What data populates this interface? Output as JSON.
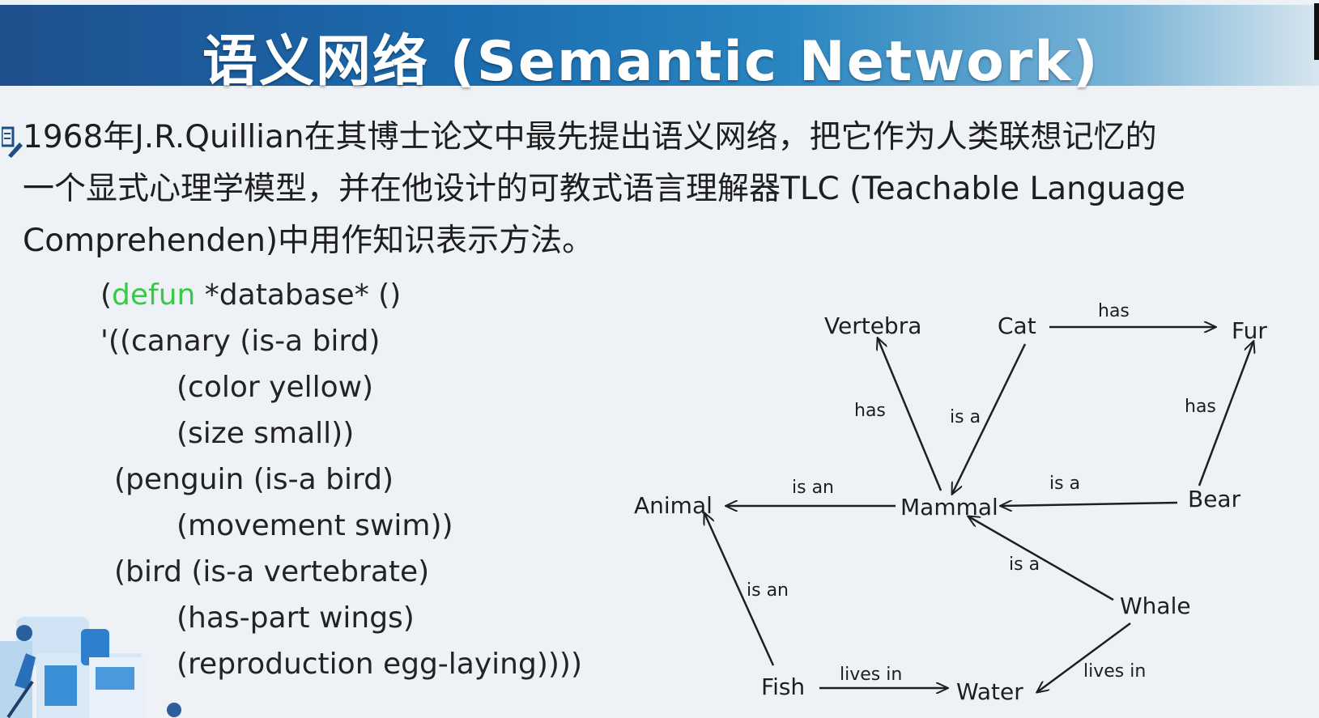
{
  "header": {
    "title": "语义网络 (Semantic Network)"
  },
  "intro": {
    "lines": [
      "1968年J.R.Quillian在其博士论文中最先提出语义网络，把它作为人类联想记忆的",
      "一个显式心理学模型，并在他设计的可教式语言理解器TLC (Teachable Language",
      "Comprehenden)中用作知识表示方法。"
    ]
  },
  "code": {
    "line1_open": "(",
    "line1_keyword": "defun",
    "line1_rest": " *database* ()",
    "line2": "'((canary  (is-a bird)",
    "line3": "(color yellow)",
    "line4": "(size small))",
    "line5": "(penguin (is-a bird)",
    "line6": "(movement swim))",
    "line7": "(bird    (is-a vertebrate)",
    "line8": "(has-part wings)",
    "line9": "(reproduction egg-laying))))",
    "keyword_color": "#39c84a"
  },
  "diagram": {
    "nodes": {
      "vertebra": "Vertebra",
      "cat": "Cat",
      "fur": "Fur",
      "animal": "Animal",
      "mammal": "Mammal",
      "bear": "Bear",
      "whale": "Whale",
      "fish": "Fish",
      "water": "Water"
    },
    "edges": {
      "cat_fur": "has",
      "mammal_vertebra": "has",
      "cat_mammal": "is a",
      "bear_fur": "has",
      "mammal_animal": "is an",
      "bear_mammal": "is a",
      "whale_mammal": "is a",
      "fish_animal": "is an",
      "fish_water": "lives in",
      "whale_water": "lives in"
    }
  },
  "colors": {
    "banner_start": "#1f4f8c",
    "banner_end": "#d8e6ef",
    "background": "#eef2f6"
  }
}
